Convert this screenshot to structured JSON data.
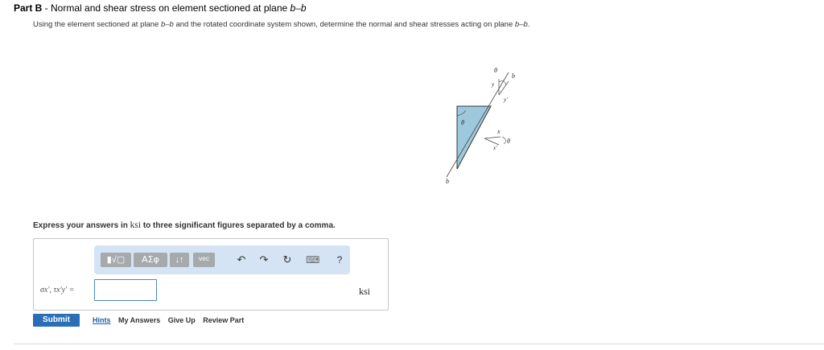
{
  "part": {
    "label": "Part B",
    "separator": " - ",
    "title": "Normal and shear stress on element sectioned at plane ",
    "plane": "b–b"
  },
  "instructions": {
    "prefix": "Using the element sectioned at plane ",
    "plane": "b–b",
    "middle": " and the rotated coordinate system shown, determine the normal and shear stresses acting on plane ",
    "plane2": "b–b",
    "suffix": "."
  },
  "figure": {
    "theta_top": "θ",
    "b_top": "b",
    "y_label": "y",
    "y_prime_label": "y'",
    "theta_left": "θ",
    "x_label": "x",
    "x_prime_label": "x'",
    "theta_right": "θ",
    "b_bottom": "b"
  },
  "express": {
    "prefix": "Express your answers in ",
    "unit": "ksi",
    "suffix": " to three significant figures separated by a comma."
  },
  "toolbar": {
    "sqrt_label": "▮√▢",
    "greek_label": "ΑΣφ",
    "arrows_label": "↓↑",
    "vec_label": "vec",
    "undo_icon": "↶",
    "redo_icon": "↷",
    "reset_icon": "↻",
    "keyboard_icon": "⌨",
    "help_label": "?"
  },
  "answer": {
    "label": "σx', τx'y' =",
    "value": "",
    "unit": "ksi"
  },
  "buttons": {
    "submit": "Submit",
    "hints": "Hints",
    "my_answers": "My Answers",
    "give_up": "Give Up",
    "review_part": "Review Part"
  },
  "colors": {
    "triangle_fill": "#9ec9dd",
    "submit_bg": "#2a6fb6",
    "toolbar_bg": "#d5e4f4",
    "input_border": "#4a86c5"
  }
}
